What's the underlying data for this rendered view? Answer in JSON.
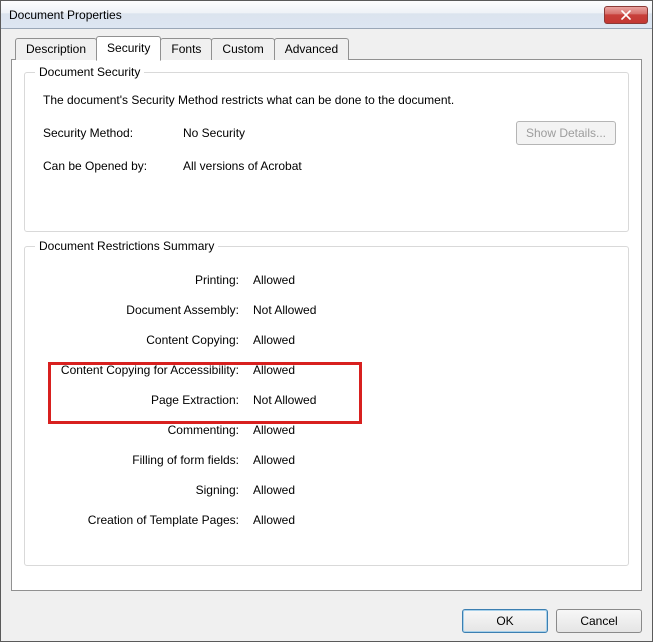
{
  "window": {
    "title": "Document Properties"
  },
  "tabs": {
    "t0": "Description",
    "t1": "Security",
    "t2": "Fonts",
    "t3": "Custom",
    "t4": "Advanced",
    "active": "Security"
  },
  "security_group": {
    "title": "Document Security",
    "description": "The document's Security Method restricts what can be done to the document.",
    "method_label": "Security Method:",
    "method_value": "No Security",
    "show_details": "Show Details...",
    "opened_label": "Can be Opened by:",
    "opened_value": "All versions of Acrobat"
  },
  "restrictions": {
    "title": "Document Restrictions Summary",
    "rows": [
      {
        "label": "Printing:",
        "value": "Allowed"
      },
      {
        "label": "Document Assembly:",
        "value": "Not Allowed"
      },
      {
        "label": "Content Copying:",
        "value": "Allowed"
      },
      {
        "label": "Content Copying for Accessibility:",
        "value": "Allowed"
      },
      {
        "label": "Page Extraction:",
        "value": "Not Allowed"
      },
      {
        "label": "Commenting:",
        "value": "Allowed"
      },
      {
        "label": "Filling of form fields:",
        "value": "Allowed"
      },
      {
        "label": "Signing:",
        "value": "Allowed"
      },
      {
        "label": "Creation of Template Pages:",
        "value": "Allowed"
      }
    ]
  },
  "buttons": {
    "ok": "OK",
    "cancel": "Cancel"
  }
}
